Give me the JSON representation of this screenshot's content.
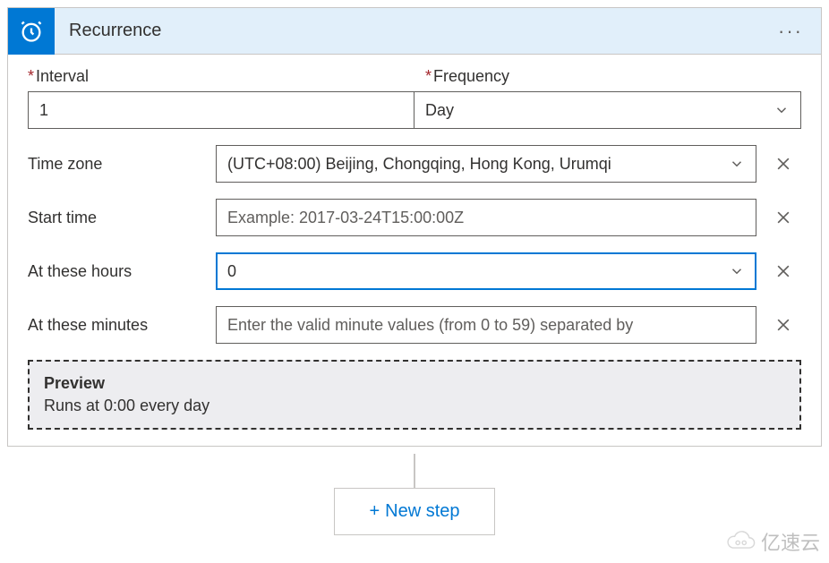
{
  "header": {
    "title": "Recurrence"
  },
  "fields": {
    "interval_label": "Interval",
    "interval_value": "1",
    "frequency_label": "Frequency",
    "frequency_value": "Day",
    "timezone_label": "Time zone",
    "timezone_value": "(UTC+08:00) Beijing, Chongqing, Hong Kong, Urumqi",
    "starttime_label": "Start time",
    "starttime_placeholder": "Example: 2017-03-24T15:00:00Z",
    "starttime_value": "",
    "hours_label": "At these hours",
    "hours_value": "0",
    "minutes_label": "At these minutes",
    "minutes_placeholder": "Enter the valid minute values (from 0 to 59) separated by",
    "minutes_value": ""
  },
  "preview": {
    "title": "Preview",
    "text": "Runs at 0:00 every day"
  },
  "footer": {
    "new_step_label": "New step"
  },
  "watermark": {
    "text": "亿速云"
  }
}
